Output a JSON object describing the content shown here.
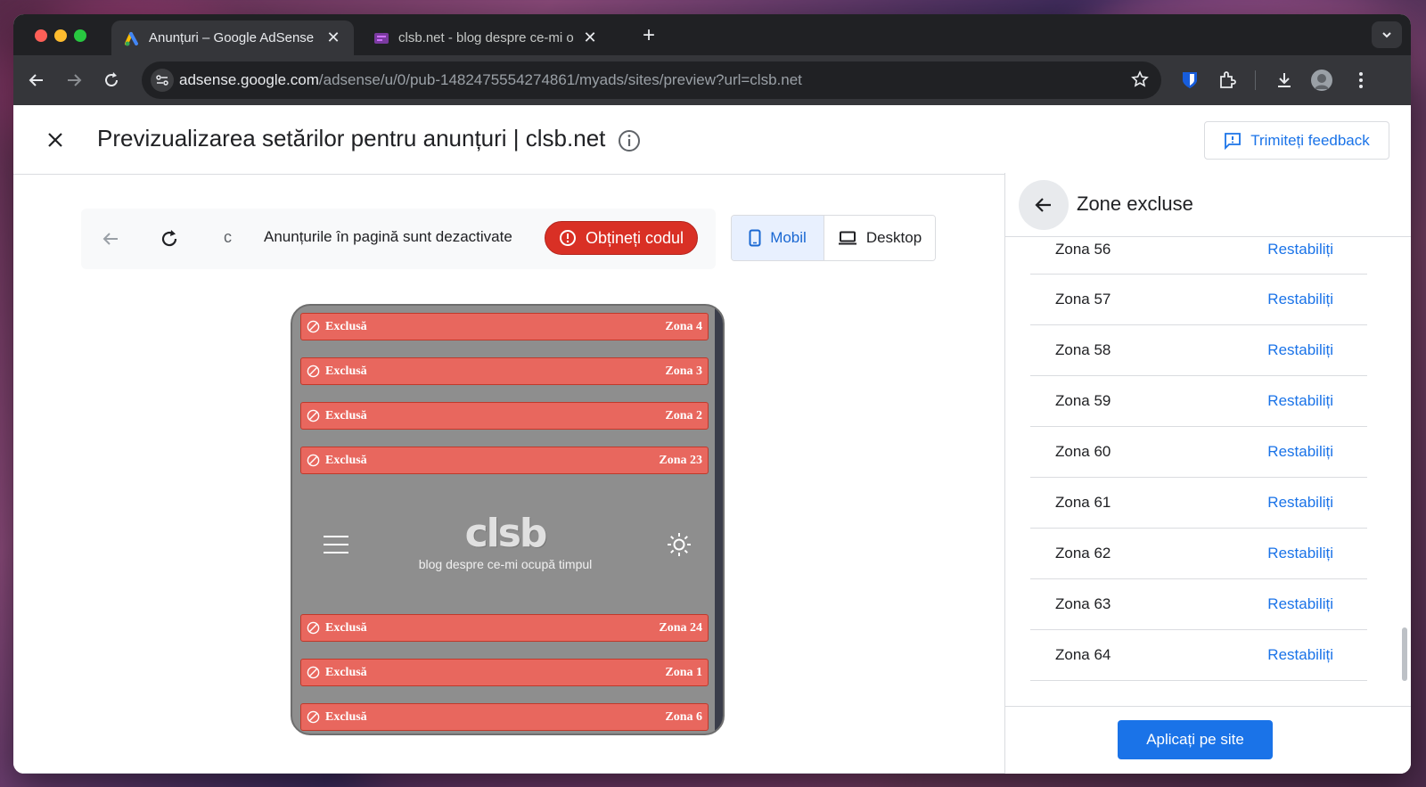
{
  "browser": {
    "tabs": [
      {
        "title": "Anunțuri – Google AdSense",
        "close": "✕"
      },
      {
        "title": "clsb.net - blog despre ce-mi o",
        "close": "✕"
      }
    ],
    "new_tab": "+",
    "url_host": "adsense.google.com",
    "url_path": "/adsense/u/0/pub-1482475554274861/myads/sites/preview?url=clsb.net"
  },
  "header": {
    "title": "Previzualizarea setărilor pentru anunțuri | clsb.net",
    "feedback_label": "Trimiteți feedback"
  },
  "preview": {
    "url_fragment": "c",
    "status": "Anunțurile în pagină sunt dezactivate",
    "get_code_label": "Obțineți codul",
    "device_mobile": "Mobil",
    "device_desktop": "Desktop"
  },
  "phone": {
    "excluded_label": "Exclusă",
    "top_zones": [
      "Zona 4",
      "Zona 3",
      "Zona 2",
      "Zona 23"
    ],
    "bottom_zones": [
      "Zona 24",
      "Zona 1",
      "Zona 6"
    ],
    "logo": "clsb",
    "tagline": "blog despre ce-mi ocupă timpul"
  },
  "panel": {
    "title": "Zone excluse",
    "restore_label": "Restabiliți",
    "zones": [
      "Zona 56",
      "Zona 57",
      "Zona 58",
      "Zona 59",
      "Zona 60",
      "Zona 61",
      "Zona 62",
      "Zona 63",
      "Zona 64"
    ],
    "apply_label": "Aplicați pe site"
  },
  "colors": {
    "accent": "#1a73e8",
    "danger": "#d93025",
    "excluded_zone": "#e8675e"
  }
}
